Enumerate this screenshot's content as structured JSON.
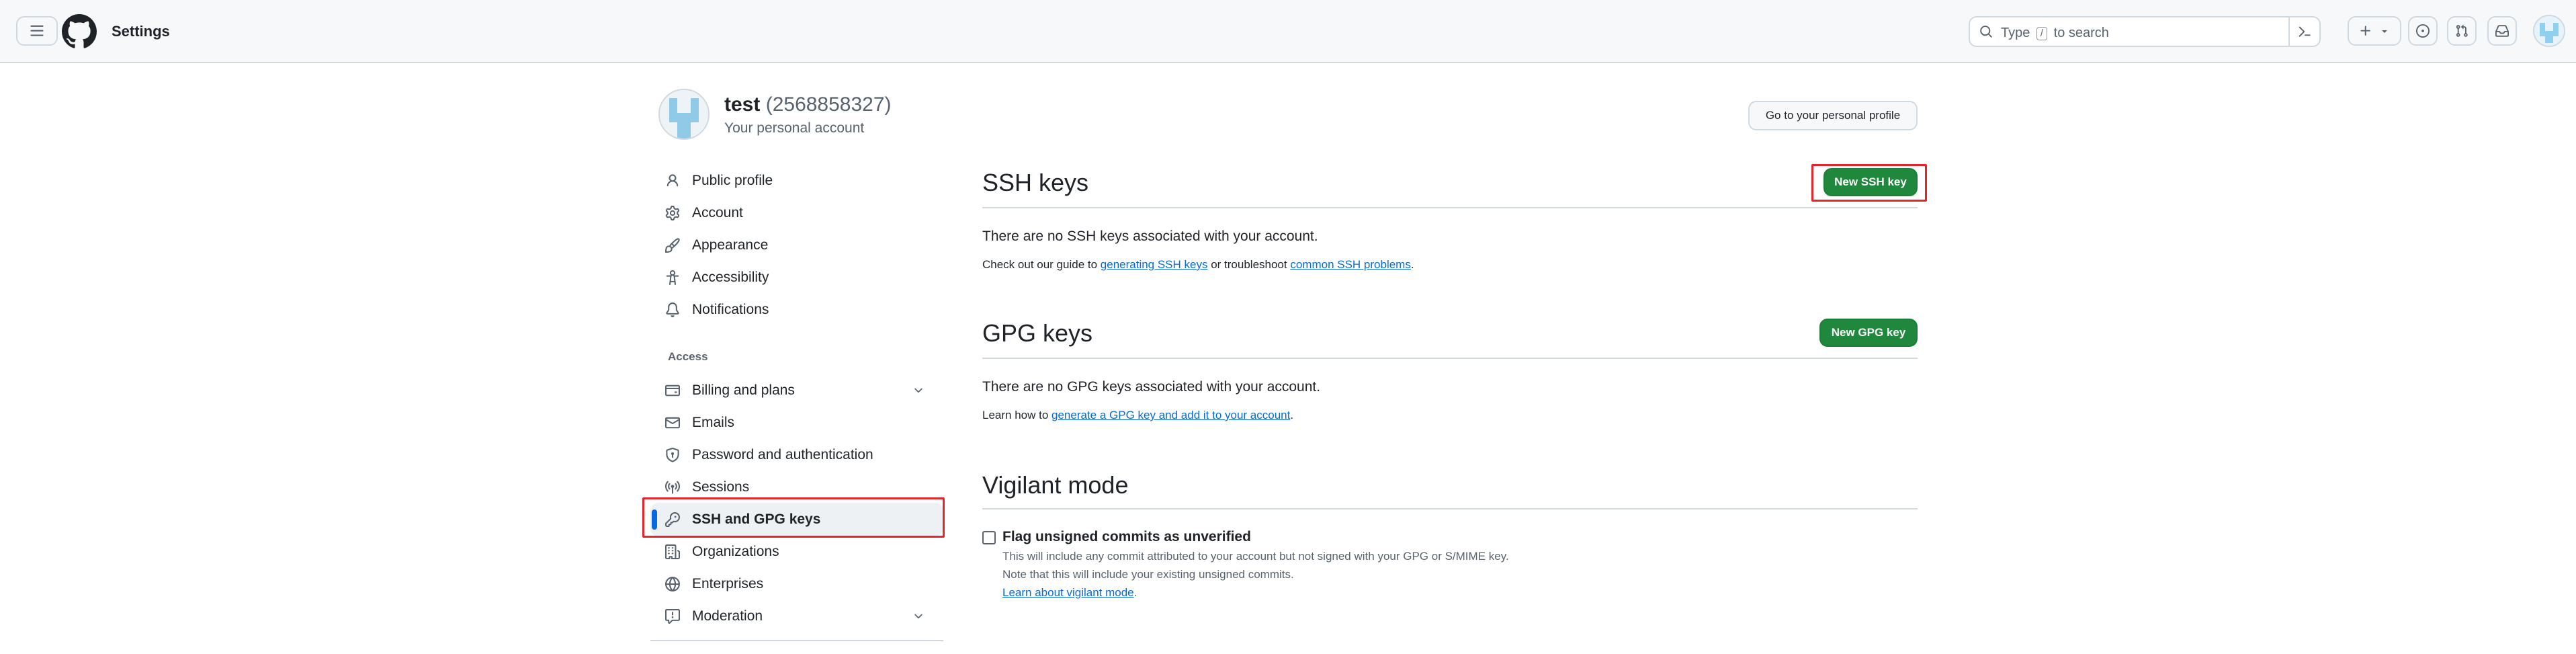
{
  "header": {
    "app_title": "Settings",
    "search_prefix": "Type",
    "search_key": "/",
    "search_suffix": "to search",
    "icons": [
      "menu-icon",
      "github-logo",
      "search-icon",
      "command-palette-icon",
      "plus-icon",
      "triangle-down-icon",
      "issue-opened-icon",
      "git-pull-request-icon",
      "inbox-icon",
      "avatar"
    ]
  },
  "account": {
    "name": "test",
    "id": "(2568858327)",
    "subtitle": "Your personal account",
    "profile_button": "Go to your personal profile"
  },
  "sidebar": {
    "items_top": [
      {
        "label": "Public profile",
        "icon": "person-icon"
      },
      {
        "label": "Account",
        "icon": "gear-icon"
      },
      {
        "label": "Appearance",
        "icon": "paintbrush-icon"
      },
      {
        "label": "Accessibility",
        "icon": "accessibility-icon"
      },
      {
        "label": "Notifications",
        "icon": "bell-icon"
      }
    ],
    "access_label": "Access",
    "items_access": [
      {
        "label": "Billing and plans",
        "icon": "credit-card-icon",
        "expandable": true
      },
      {
        "label": "Emails",
        "icon": "mail-icon"
      },
      {
        "label": "Password and authentication",
        "icon": "shield-lock-icon"
      },
      {
        "label": "Sessions",
        "icon": "broadcast-icon"
      },
      {
        "label": "SSH and GPG keys",
        "icon": "key-icon",
        "active": true
      },
      {
        "label": "Organizations",
        "icon": "organization-icon"
      },
      {
        "label": "Enterprises",
        "icon": "globe-icon"
      },
      {
        "label": "Moderation",
        "icon": "report-icon",
        "expandable": true
      }
    ]
  },
  "ssh": {
    "title": "SSH keys",
    "button": "New SSH key",
    "empty": "There are no SSH keys associated with your account.",
    "guide_prefix": "Check out our guide to ",
    "guide_link": "generating SSH keys",
    "guide_middle": " or troubleshoot ",
    "guide_link2": "common SSH problems",
    "guide_suffix": "."
  },
  "gpg": {
    "title": "GPG keys",
    "button": "New GPG key",
    "empty": "There are no GPG keys associated with your account.",
    "learn_prefix": "Learn how to ",
    "learn_link": "generate a GPG key and add it to your account",
    "learn_suffix": "."
  },
  "vigilant": {
    "title": "Vigilant mode",
    "checkbox_label": "Flag unsigned commits as unverified",
    "checked": false,
    "note1": "This will include any commit attributed to your account but not signed with your GPG or S/MIME key.",
    "note2": "Note that this will include your existing unsigned commits.",
    "learn_link": "Learn about vigilant mode",
    "learn_suffix": "."
  },
  "colors": {
    "accent": "#0969da",
    "primary_button": "#1f883d",
    "highlight_box": "#e5252a"
  }
}
